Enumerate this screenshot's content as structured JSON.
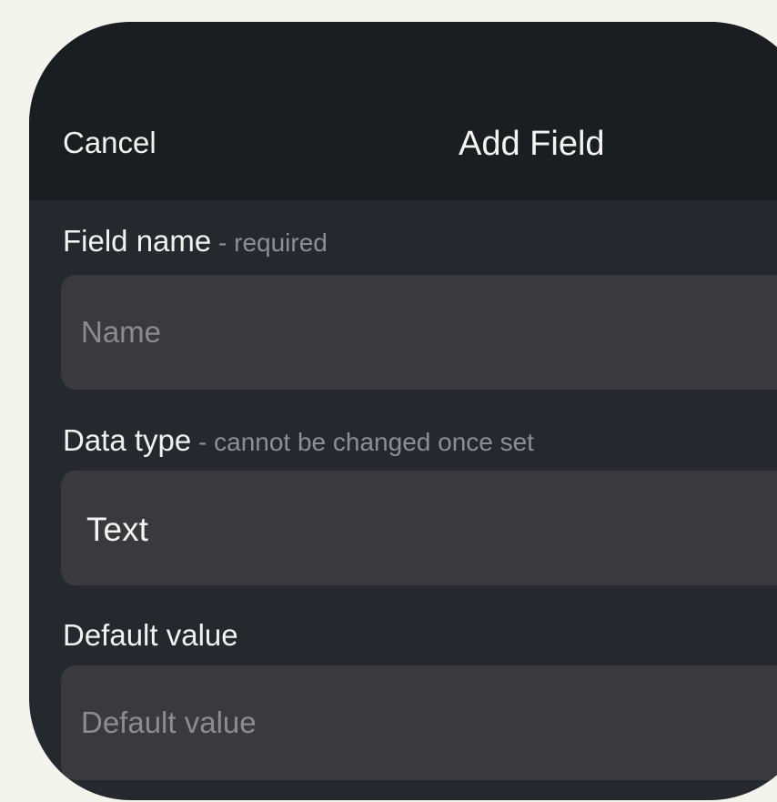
{
  "navbar": {
    "cancel_label": "Cancel",
    "title": "Add Field"
  },
  "field_name": {
    "label": "Field name",
    "hint": " - required",
    "placeholder": "Name",
    "value": ""
  },
  "data_type": {
    "label": "Data type",
    "hint": " - cannot be changed once set",
    "selected": "Text"
  },
  "default_value": {
    "label": "Default value",
    "placeholder": "Default value",
    "value": ""
  },
  "colors": {
    "background": "#f4f4ef",
    "sheet": "#25292d",
    "navbar": "#1b1e21",
    "field": "#3a393e",
    "text": "#f2f2f2",
    "hint": "#8e8e93"
  }
}
